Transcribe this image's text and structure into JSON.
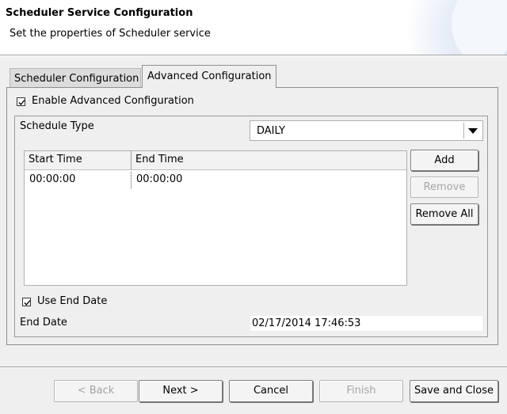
{
  "header": {
    "title": "Scheduler Service Configuration",
    "subtitle": "Set the properties of Scheduler service"
  },
  "tabs": [
    {
      "label": "Scheduler Configuration",
      "active": false
    },
    {
      "label": "Advanced Configuration",
      "active": true
    }
  ],
  "advanced": {
    "enable_label": "Enable Advanced Configuration",
    "enable_checked": true,
    "schedule_type_label": "Schedule Type",
    "schedule_type_value": "DAILY",
    "table": {
      "columns": [
        "Start Time",
        "End Time"
      ],
      "rows": [
        [
          "00:00:00",
          "00:00:00"
        ]
      ]
    },
    "buttons": {
      "add": "Add",
      "remove": "Remove",
      "remove_all": "Remove All"
    },
    "use_end_date_label": "Use End Date",
    "use_end_date_checked": true,
    "end_date_label": "End Date",
    "end_date_value": "02/17/2014 17:46:53"
  },
  "footer": {
    "back": "< Back",
    "next": "Next >",
    "cancel": "Cancel",
    "finish": "Finish",
    "save_close": "Save and Close"
  }
}
